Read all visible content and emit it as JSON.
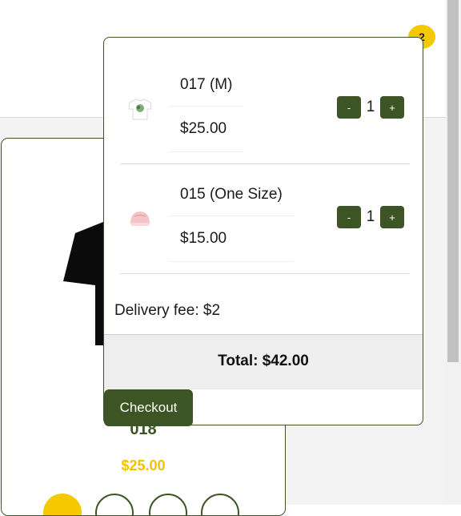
{
  "header": {
    "cart_count": "2"
  },
  "product": {
    "name": "018",
    "price": "$25.00"
  },
  "cart": {
    "items": [
      {
        "name": "017 (M)",
        "price": "$25.00",
        "quantity": "1",
        "decrement_label": "-",
        "increment_label": "+",
        "thumb_icon": "white-tshirt-icon"
      },
      {
        "name": "015 (One Size)",
        "price": "$15.00",
        "quantity": "1",
        "decrement_label": "-",
        "increment_label": "+",
        "thumb_icon": "pink-cap-icon"
      }
    ],
    "delivery_fee": "Delivery fee: $2",
    "total": "Total: $42.00",
    "checkout_label": "Checkout"
  },
  "colors": {
    "accent": "#3d5524",
    "price_yellow": "#f5c000",
    "badge_yellow": "#f5c900"
  }
}
